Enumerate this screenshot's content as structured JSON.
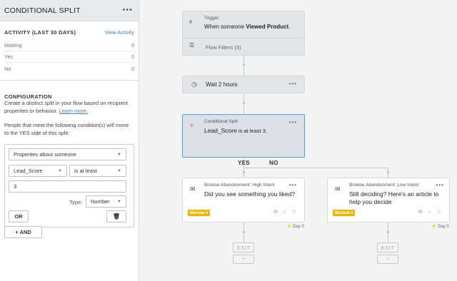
{
  "sidebar": {
    "title": "CONDITIONAL SPLIT",
    "menu_icon": "more-dots-icon",
    "activity": {
      "heading": "ACTIVITY (LAST 30 DAYS)",
      "view_link": "View Activity",
      "rows": [
        {
          "label": "Waiting",
          "value": "0"
        },
        {
          "label": "Yes",
          "value": "0"
        },
        {
          "label": "No",
          "value": "0"
        }
      ]
    },
    "configuration": {
      "heading": "CONFIGURATION",
      "desc_before": "Create a distinct split in your flow based on recipient properties or behavior. ",
      "learn_more": "Learn more.",
      "condition_desc": "People that meet the following condition(s) will move to the YES side of this split:",
      "property_select": "Properties about someone",
      "field_select": "Lead_Score",
      "operator_select": "is at least",
      "value_input": "3",
      "type_label": "Type:",
      "type_select": "Number",
      "or_button": "OR",
      "trash_icon": "trash-icon",
      "and_button": "+ AND"
    }
  },
  "flow": {
    "trigger": {
      "label": "Trigger",
      "text_before": "When someone ",
      "text_bold": "Viewed Product",
      "text_after": ".",
      "filters": "Flow Filters (3)"
    },
    "wait": {
      "text": "Wait 2 hours"
    },
    "split": {
      "label": "Conditional Split",
      "text_bold": "Lead_Score",
      "text_rest": " is at least 3."
    },
    "branches": {
      "yes": "YES",
      "no": "NO"
    },
    "email_high": {
      "label": "Browse Abandonment: High Intent",
      "subject": "Did you see something you liked?",
      "status": "Manual",
      "day": "Day 0"
    },
    "email_low": {
      "label": "Browse Abandonment: Low Intent",
      "subject_line1": "Still deciding? Here's an article to",
      "subject_line2": "help you decide",
      "status": "Manual",
      "day": "Day 0"
    },
    "exit_label": "EXIT"
  },
  "colors": {
    "link": "#3a7fd5",
    "selected_border": "#4aa3df",
    "manual_badge": "#f2b400"
  }
}
